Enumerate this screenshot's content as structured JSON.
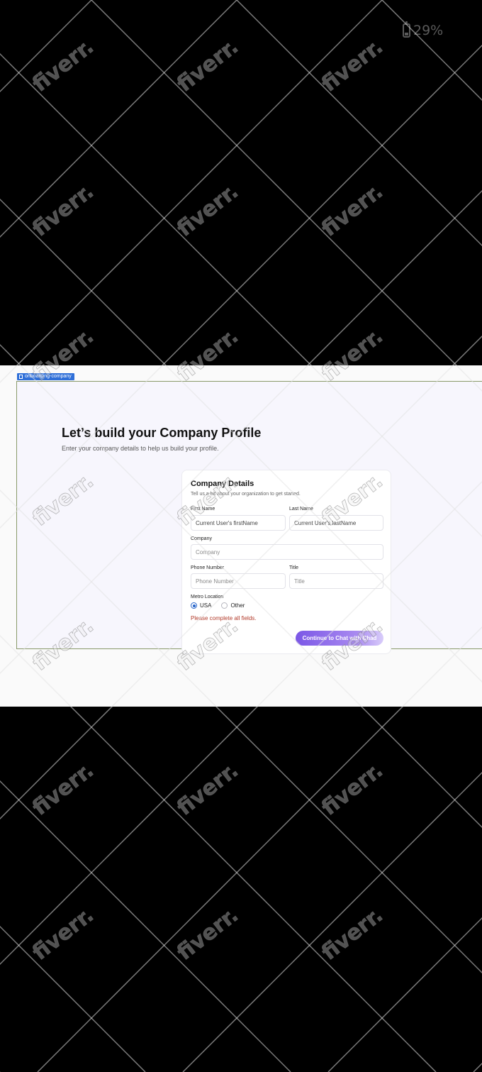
{
  "status_bar": {
    "battery_icon": "battery-icon",
    "battery_percent": "29%"
  },
  "frame": {
    "tag_label": "onboarding-company",
    "tag_color": "#2f6fd8"
  },
  "header": {
    "title": "Let’s build your Company Profile",
    "subtitle": "Enter your company details to help us build your profile."
  },
  "card": {
    "title": "Company Details",
    "subtitle": "Tell us a bit about your organization to get started.",
    "first_name": {
      "label": "First Name",
      "value": "Current User's firstName"
    },
    "last_name": {
      "label": "Last Name",
      "value": "Current User's lastName"
    },
    "company": {
      "label": "Company",
      "placeholder": "Company"
    },
    "phone": {
      "label": "Phone Number",
      "placeholder": "Phone Number"
    },
    "title_field": {
      "label": "Title",
      "placeholder": "Title"
    },
    "metro": {
      "label": "Metro Location",
      "options": [
        "USA",
        "Other"
      ],
      "selected": "USA"
    },
    "error": "Please complete all fields.",
    "continue_label": "Continue to Chat with Chad"
  },
  "colors": {
    "accent": "#7b57e6",
    "error": "#b23a2a",
    "radio_selected": "#2563c9"
  },
  "watermark": {
    "text": "fiverr."
  }
}
